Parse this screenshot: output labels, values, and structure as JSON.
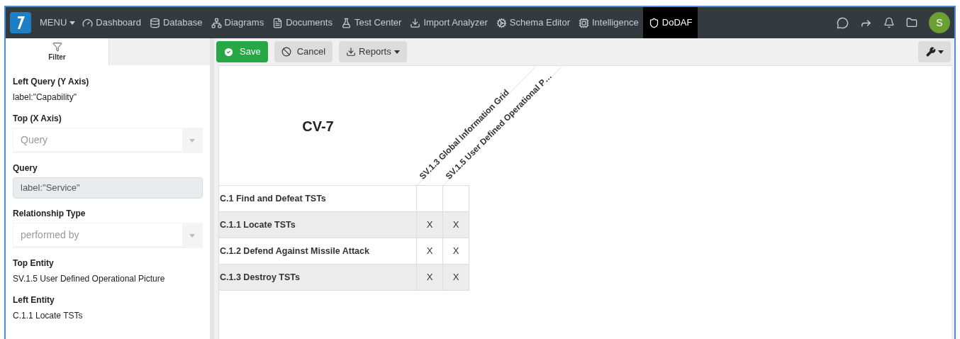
{
  "nav": {
    "menu": "MENU",
    "items": [
      {
        "label": "Dashboard",
        "selected": false
      },
      {
        "label": "Database",
        "selected": false
      },
      {
        "label": "Diagrams",
        "selected": false
      },
      {
        "label": "Documents",
        "selected": false
      },
      {
        "label": "Test Center",
        "selected": false
      },
      {
        "label": "Import Analyzer",
        "selected": false
      },
      {
        "label": "Schema Editor",
        "selected": false
      },
      {
        "label": "Intelligence",
        "selected": false
      },
      {
        "label": "DoDAF",
        "selected": true
      }
    ],
    "avatar": "S"
  },
  "sidebar": {
    "tab": "Filter",
    "fields": [
      {
        "kind": "text",
        "label": "Left Query (Y Axis)",
        "value": "label:\"Capability\""
      },
      {
        "kind": "select",
        "label": "Top (X Axis)",
        "placeholder": "Query"
      },
      {
        "kind": "input",
        "label": "Query",
        "value": "label:\"Service\""
      },
      {
        "kind": "select",
        "label": "Relationship Type",
        "placeholder": "performed by"
      },
      {
        "kind": "text",
        "label": "Top Entity",
        "value": "SV.1.5 User Defined Operational Picture"
      },
      {
        "kind": "text",
        "label": "Left Entity",
        "value": "C.1.1 Locate TSTs"
      }
    ]
  },
  "toolbar": {
    "save": "Save",
    "cancel": "Cancel",
    "reports": "Reports"
  },
  "matrix": {
    "title": "CV-7",
    "columns": [
      "SV.1.3 Global Information Grid",
      "SV.1.5 User Defined Operational P…"
    ],
    "rows": [
      {
        "label": "C.1 Find and Defeat TSTs",
        "cells": [
          "",
          ""
        ]
      },
      {
        "label": "C.1.1 Locate TSTs",
        "cells": [
          "X",
          "X"
        ]
      },
      {
        "label": "C.1.2 Defend Against Missile Attack",
        "cells": [
          "X",
          "X"
        ]
      },
      {
        "label": "C.1.3 Destroy TSTs",
        "cells": [
          "X",
          "X"
        ]
      }
    ]
  }
}
